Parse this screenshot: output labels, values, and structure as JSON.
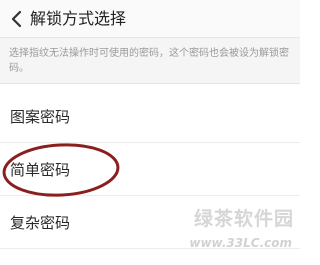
{
  "header": {
    "title": "解锁方式选择",
    "back_icon": "chevron-left-icon"
  },
  "description": "选择指纹无法操作时可使用的密码，这个密码也会被设为解锁密码。",
  "options": [
    {
      "label": "图案密码"
    },
    {
      "label": "简单密码",
      "circled": true
    },
    {
      "label": "复杂密码"
    }
  ],
  "annotation": {
    "color": "#8b1e1e"
  },
  "watermark": {
    "name": "绿茶软件园",
    "url": "www.33LC.com"
  }
}
